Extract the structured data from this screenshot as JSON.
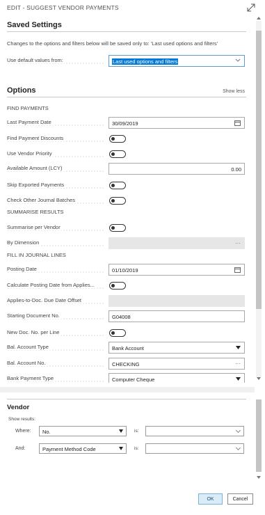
{
  "window": {
    "title": "EDIT - SUGGEST VENDOR PAYMENTS",
    "expand_icon": "expand-diagonal-icon"
  },
  "saved_settings": {
    "heading": "Saved Settings",
    "note": "Changes to the options and filters below will be saved only to: 'Last used options and filters'",
    "default_label": "Use default values from:",
    "default_value": "Last used options and filters"
  },
  "options": {
    "heading": "Options",
    "show_less": "Show less",
    "find_payments": {
      "group": "FIND PAYMENTS",
      "last_payment_date_label": "Last Payment Date",
      "last_payment_date_value": "30/09/2019",
      "find_payment_discounts_label": "Find Payment Discounts",
      "find_payment_discounts_on": false,
      "use_vendor_priority_label": "Use Vendor Priority",
      "use_vendor_priority_on": false,
      "available_amount_label": "Available Amount (LCY)",
      "available_amount_value": "0.00",
      "skip_exported_label": "Skip Exported Payments",
      "skip_exported_on": false,
      "check_other_batches_label": "Check Other Journal Batches",
      "check_other_batches_on": false
    },
    "summarise_results": {
      "group": "SUMMARISE RESULTS",
      "summarise_per_vendor_label": "Summarise per Vendor",
      "summarise_per_vendor_on": false,
      "by_dimension_label": "By Dimension",
      "by_dimension_value": "···"
    },
    "fill_in_journal_lines": {
      "group": "FILL IN JOURNAL LINES",
      "posting_date_label": "Posting Date",
      "posting_date_value": "01/10/2019",
      "calc_posting_date_label": "Calculate Posting Date from Applies...",
      "calc_posting_date_on": false,
      "due_date_offset_label": "Applies-to-Doc. Due Date Offset",
      "starting_doc_no_label": "Starting Document No.",
      "starting_doc_no_value": "G04008",
      "new_doc_no_label": "New Doc. No. per Line",
      "new_doc_no_on": false,
      "bal_account_type_label": "Bal. Account Type",
      "bal_account_type_value": "Bank Account",
      "bal_account_no_label": "Bal. Account No.",
      "bal_account_no_value": "CHECKING",
      "bal_account_no_trail": "···",
      "bank_payment_type_label": "Bank Payment Type",
      "bank_payment_type_value": "Computer Cheque"
    }
  },
  "vendor": {
    "heading": "Vendor",
    "show_results": "Show results:",
    "where_label": "Where:",
    "where_field": "No.",
    "is_label_1": "is:",
    "and_label": "And:",
    "and_field": "Payment Method Code",
    "is_label_2": "is:"
  },
  "buttons": {
    "ok": "OK",
    "cancel": "Cancel"
  },
  "colors": {
    "selection": "#0078d4",
    "ok_bg": "#d9ecf8"
  }
}
